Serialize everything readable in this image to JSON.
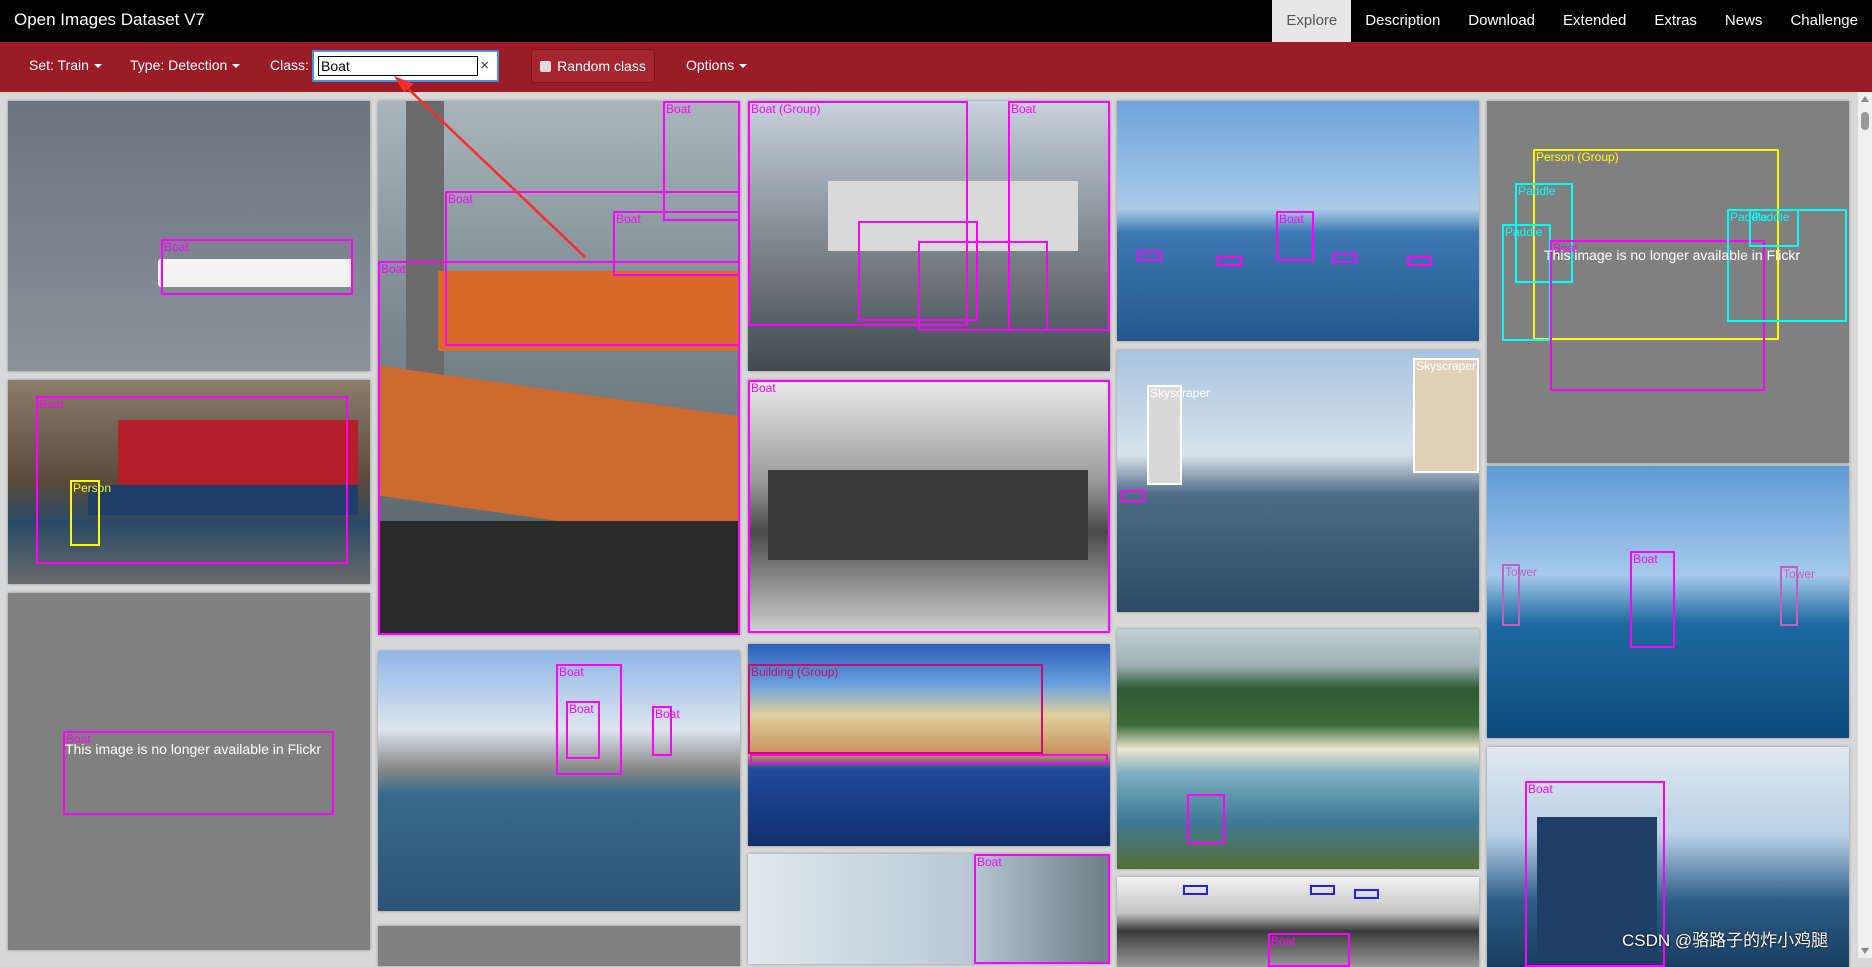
{
  "app": {
    "title": "Open Images Dataset V7"
  },
  "nav": {
    "items": [
      {
        "label": "Explore",
        "active": true
      },
      {
        "label": "Description"
      },
      {
        "label": "Download"
      },
      {
        "label": "Extended"
      },
      {
        "label": "Extras"
      },
      {
        "label": "News"
      },
      {
        "label": "Challenge"
      }
    ]
  },
  "toolbar": {
    "set_label": "Set: Train",
    "type_label": "Type: Detection",
    "class_label": "Class:",
    "class_value": "Boat",
    "clear_symbol": "×",
    "random_label": "Random class",
    "options_label": "Options"
  },
  "colors": {
    "toolbar_bg": "#9a1c27",
    "bbox_magenta": "#ff00ff",
    "bbox_cyan": "#00ffff",
    "bbox_yellow": "#ffff00",
    "unavailable_bg": "#808080"
  },
  "tiles": {
    "cruise": {
      "boat": "Boat"
    },
    "tug": {
      "b1": "Boat",
      "b2": "Boat",
      "b3": "Boat",
      "b4": "Boat"
    },
    "marina": {
      "group": "Boat (Group)",
      "b1": "Boat"
    },
    "sea": {
      "b1": "Boat"
    },
    "unavail_top": {
      "person_group": "Person (Group)",
      "paddle1": "Paddle",
      "paddle2": "Paddle",
      "paddle3": "Paddle",
      "paddle4": "Paddle",
      "boat": "Boat",
      "message": "This image is no longer available in Flickr"
    },
    "fishing": {
      "person": "Person",
      "boat": "Boat"
    },
    "soldiers": {
      "boat": "Boat"
    },
    "bridge": {
      "sky1": "Skyscraper",
      "sky2": "Skyscraper"
    },
    "unavail_left": {
      "boat": "Boat",
      "message": "This image is no longer available in Flickr"
    },
    "harbor": {
      "b1": "Boat",
      "b2": "Boat",
      "b3": "Boat"
    },
    "colorful": {
      "group": "Building (Group)"
    },
    "sailboat": {
      "boat": "Boat",
      "tower1": "Tower",
      "tower2": "Tower"
    },
    "city": {
      "boat": "Boat"
    },
    "fishboat": {
      "boat": "Boat"
    },
    "bottom_mid": {
      "boat": "Boat"
    }
  },
  "watermark": "CSDN @骆路子的炸小鸡腿"
}
